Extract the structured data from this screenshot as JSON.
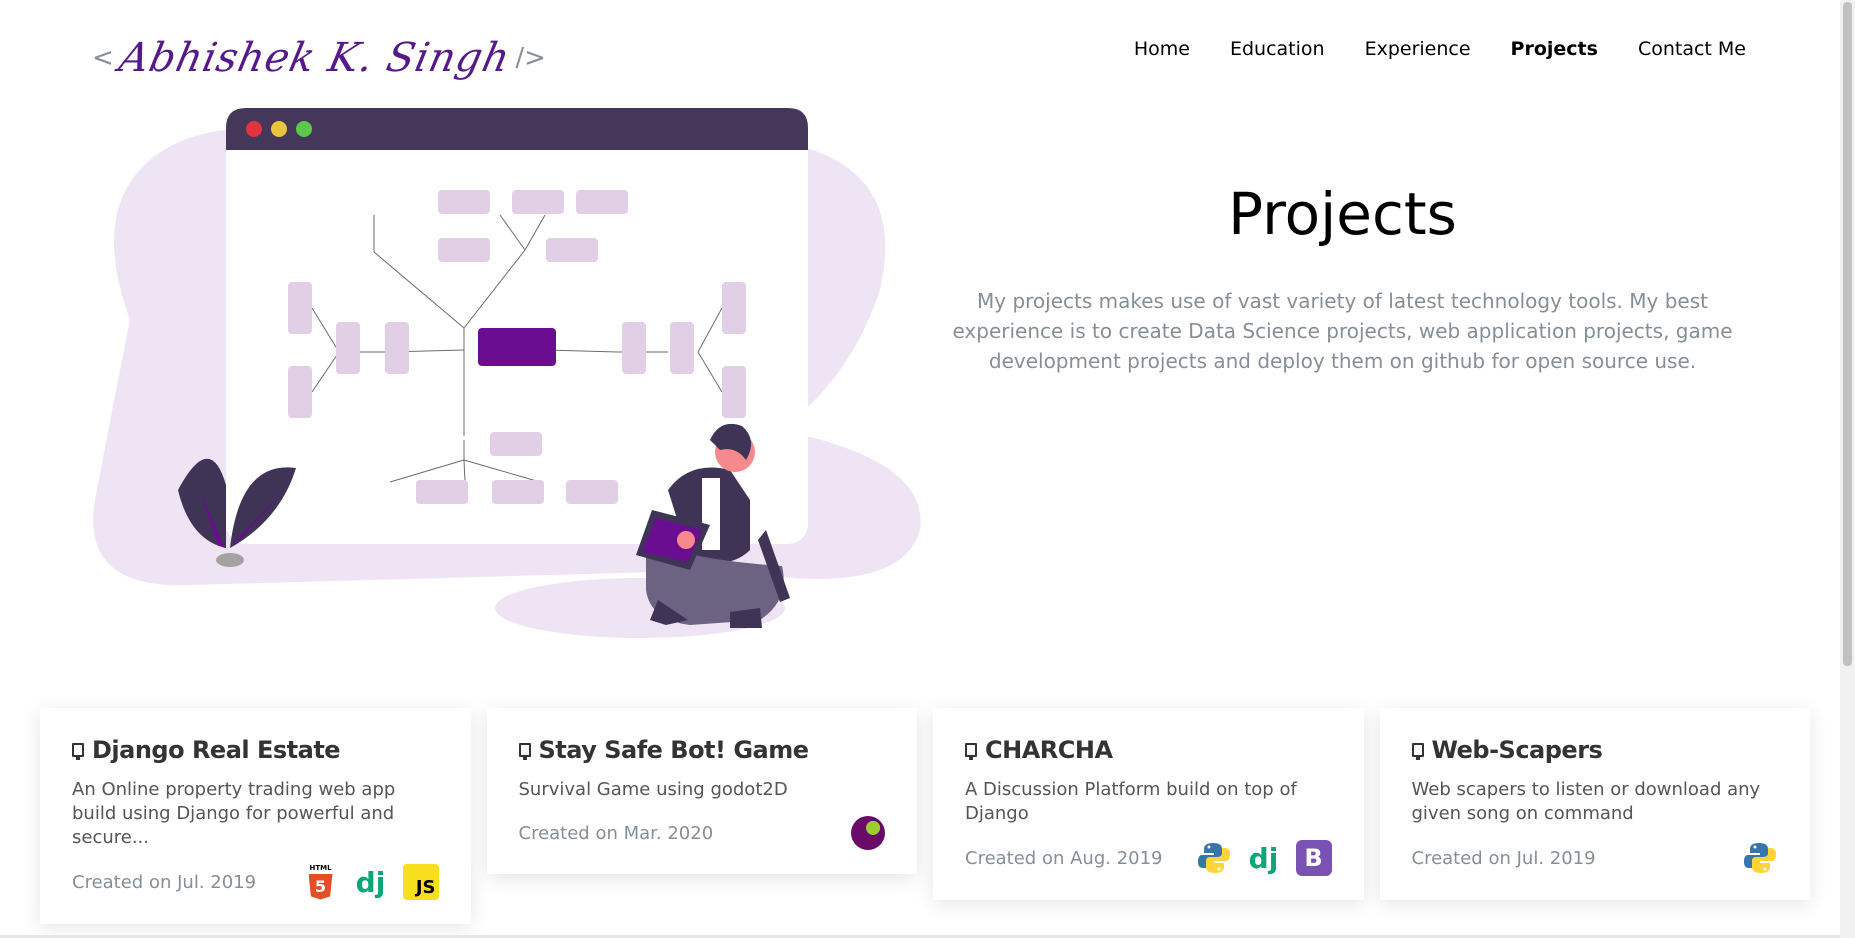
{
  "header": {
    "logo": {
      "open": "<",
      "signature": "Abhishek K. Singh",
      "close": "/>"
    },
    "nav": [
      "Home",
      "Education",
      "Experience",
      "Projects",
      "Contact Me"
    ],
    "active_nav": "Projects"
  },
  "hero": {
    "title": "Projects",
    "description": "My projects makes use of vast variety of latest technology tools. My best experience is to create Data Science projects, web application projects, game development projects and deploy them on github for open source use."
  },
  "projects": [
    {
      "title": "Django Real Estate",
      "description": "An Online property trading web app build using Django for powerful and secure...",
      "date": "Created on Jul. 2019",
      "languages": [
        "html5-icon",
        "django-icon",
        "javascript-icon"
      ]
    },
    {
      "title": "Stay Safe Bot! Game",
      "description": "Survival Game using godot2D",
      "date": "Created on Mar. 2020",
      "languages": [
        "godot-icon"
      ]
    },
    {
      "title": "CHARCHA",
      "description": "A Discussion Platform build on top of Django",
      "date": "Created on Aug. 2019",
      "languages": [
        "python-icon",
        "django-icon",
        "bootstrap-icon"
      ]
    },
    {
      "title": "Web-Scapers",
      "description": "Web scapers to listen or download any given song on command",
      "date": "Created on Jul. 2019",
      "languages": [
        "python-icon"
      ]
    }
  ],
  "icon_text": {
    "html": "HTML",
    "html5": "5",
    "dj": "dj",
    "js": "JS",
    "bs": "B"
  },
  "colors": {
    "accent": "#55198b",
    "muted": "#868e96",
    "blob": "#efe4f3",
    "window_bar": "#453759"
  }
}
